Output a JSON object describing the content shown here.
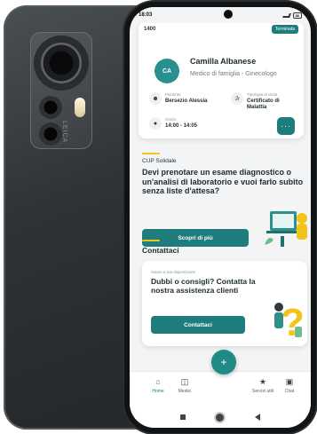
{
  "status_bar": {
    "time": "18:03",
    "battery": "86"
  },
  "appointment": {
    "time_top": "1400",
    "badge": "Terminata",
    "avatar_initials": "CA",
    "doctor_name": "Camilla Albanese",
    "doctor_role": "Medico di famiglia - Ginecologo",
    "patient_label": "Paziente",
    "patient_name": "Bersezio Alessia",
    "visit_type_label": "Tipologia di visita",
    "visit_type_value": "Certificato di Malattia",
    "time_label": "Orario",
    "time_value": "14:00 - 14:05",
    "more_button": "···"
  },
  "cup": {
    "label": "CUP Solidale",
    "title": "Devi prenotare un esame diagnostico o un'analisi di laboratorio e vuoi farlo subito senza liste d'attesa?",
    "button": "Scopri di più"
  },
  "contact": {
    "section_title": "Contattaci",
    "subtitle": "Siamo a tua disposizione",
    "title": "Dubbi o consigli? Contatta la nostra assistenza clienti",
    "button": "Contattaci"
  },
  "bottom_nav": {
    "fab": "+",
    "items": [
      {
        "label": "Home",
        "icon": "home-icon"
      },
      {
        "label": "Medici",
        "icon": "doctor-bag-icon"
      },
      {
        "label": "Servizi utili",
        "icon": "star-icon"
      },
      {
        "label": "Chat",
        "icon": "chat-icon"
      }
    ]
  },
  "back_phone": {
    "brand_mark": "LEICA"
  },
  "colors": {
    "accent": "#1f7c7c",
    "highlight": "#f0c419"
  }
}
